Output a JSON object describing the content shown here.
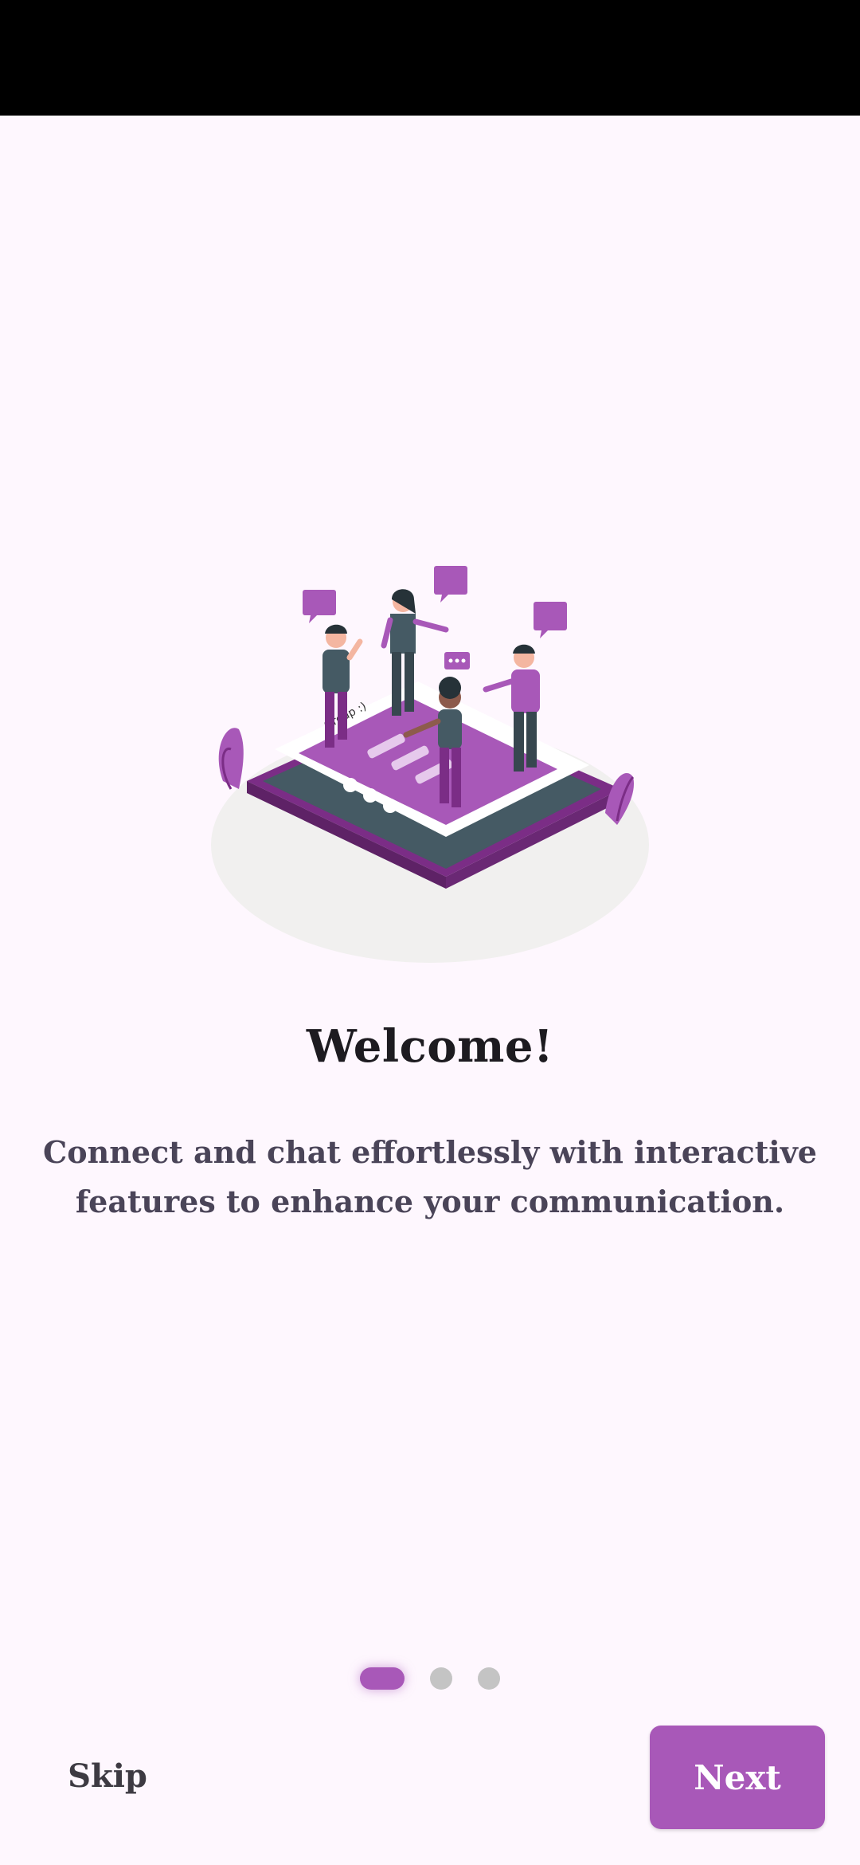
{
  "onboarding": {
    "title": "Welcome!",
    "description": "Connect and chat effortlessly with interactive features to enhance your communication.",
    "page_indicator": {
      "total": 3,
      "active": 1
    },
    "skip_label": "Skip",
    "next_label": "Next",
    "illustration_icon": "group-chat-illustration",
    "illustration_chat_text": "Group :)"
  },
  "colors": {
    "accent": "#a858b8",
    "background": "#fef7fe",
    "title": "#1d1b20",
    "body": "#4a4458",
    "dot_inactive": "#c4c4c4"
  }
}
